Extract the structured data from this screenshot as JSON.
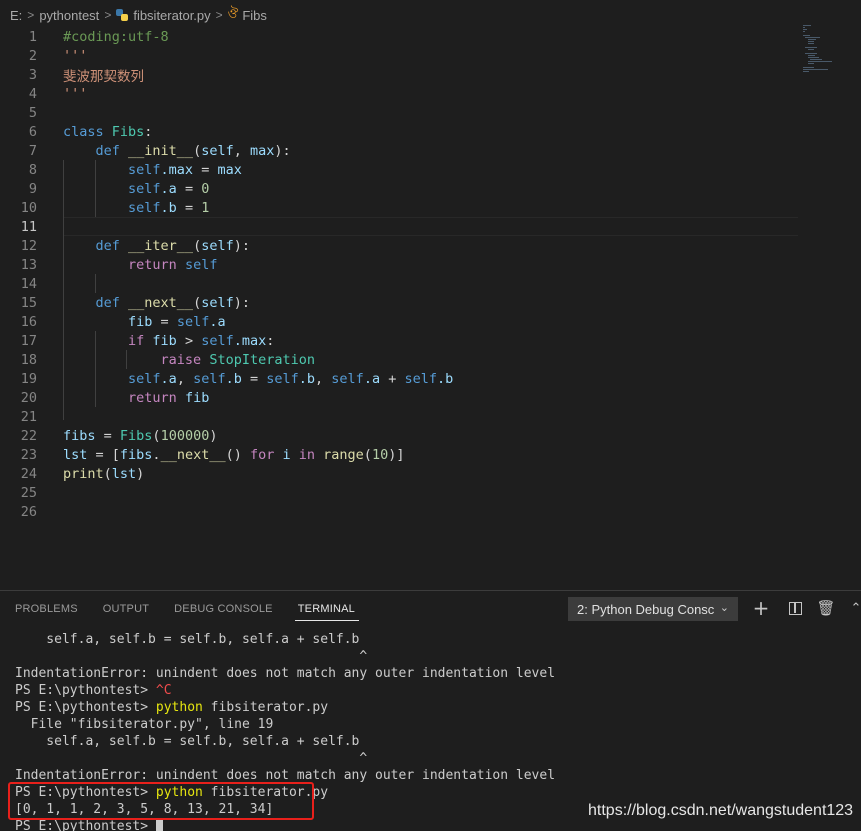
{
  "breadcrumb": {
    "root": "E:",
    "folder": "pythontest",
    "file": "fibsiterator.py",
    "symbol": "Fibs"
  },
  "editor": {
    "current_line": 11,
    "lines": [
      {
        "n": "1",
        "tokens": [
          {
            "t": "#coding:utf-8",
            "c": "com"
          }
        ]
      },
      {
        "n": "2",
        "tokens": [
          {
            "t": "'''",
            "c": "str"
          }
        ]
      },
      {
        "n": "3",
        "tokens": [
          {
            "t": "斐波那契数列",
            "c": "str"
          }
        ]
      },
      {
        "n": "4",
        "tokens": [
          {
            "t": "'''",
            "c": "str"
          }
        ]
      },
      {
        "n": "5",
        "tokens": []
      },
      {
        "n": "6",
        "tokens": [
          {
            "t": "class ",
            "c": "kw"
          },
          {
            "t": "Fibs",
            "c": "cls"
          },
          {
            "t": ":",
            "c": "plain"
          }
        ]
      },
      {
        "n": "7",
        "tokens": [
          {
            "t": "    ",
            "c": "plain"
          },
          {
            "t": "def ",
            "c": "kw"
          },
          {
            "t": "__init__",
            "c": "fn"
          },
          {
            "t": "(",
            "c": "plain"
          },
          {
            "t": "self",
            "c": "var"
          },
          {
            "t": ", ",
            "c": "plain"
          },
          {
            "t": "max",
            "c": "var"
          },
          {
            "t": "):",
            "c": "plain"
          }
        ]
      },
      {
        "n": "8",
        "tokens": [
          {
            "t": "        ",
            "c": "plain"
          },
          {
            "t": "self",
            "c": "self"
          },
          {
            "t": ".max",
            "c": "var"
          },
          {
            "t": " = ",
            "c": "plain"
          },
          {
            "t": "max",
            "c": "var"
          }
        ]
      },
      {
        "n": "9",
        "tokens": [
          {
            "t": "        ",
            "c": "plain"
          },
          {
            "t": "self",
            "c": "self"
          },
          {
            "t": ".a",
            "c": "var"
          },
          {
            "t": " = ",
            "c": "plain"
          },
          {
            "t": "0",
            "c": "num"
          }
        ]
      },
      {
        "n": "10",
        "tokens": [
          {
            "t": "        ",
            "c": "plain"
          },
          {
            "t": "self",
            "c": "self"
          },
          {
            "t": ".b",
            "c": "var"
          },
          {
            "t": " = ",
            "c": "plain"
          },
          {
            "t": "1",
            "c": "num"
          }
        ]
      },
      {
        "n": "11",
        "tokens": []
      },
      {
        "n": "12",
        "tokens": [
          {
            "t": "    ",
            "c": "plain"
          },
          {
            "t": "def ",
            "c": "kw"
          },
          {
            "t": "__iter__",
            "c": "fn"
          },
          {
            "t": "(",
            "c": "plain"
          },
          {
            "t": "self",
            "c": "var"
          },
          {
            "t": "):",
            "c": "plain"
          }
        ]
      },
      {
        "n": "13",
        "tokens": [
          {
            "t": "        ",
            "c": "plain"
          },
          {
            "t": "return ",
            "c": "ctl"
          },
          {
            "t": "self",
            "c": "self"
          }
        ]
      },
      {
        "n": "14",
        "tokens": []
      },
      {
        "n": "15",
        "tokens": [
          {
            "t": "    ",
            "c": "plain"
          },
          {
            "t": "def ",
            "c": "kw"
          },
          {
            "t": "__next__",
            "c": "fn"
          },
          {
            "t": "(",
            "c": "plain"
          },
          {
            "t": "self",
            "c": "var"
          },
          {
            "t": "):",
            "c": "plain"
          }
        ]
      },
      {
        "n": "16",
        "tokens": [
          {
            "t": "        ",
            "c": "plain"
          },
          {
            "t": "fib",
            "c": "var"
          },
          {
            "t": " = ",
            "c": "plain"
          },
          {
            "t": "self",
            "c": "self"
          },
          {
            "t": ".a",
            "c": "var"
          }
        ]
      },
      {
        "n": "17",
        "tokens": [
          {
            "t": "        ",
            "c": "plain"
          },
          {
            "t": "if ",
            "c": "ctl"
          },
          {
            "t": "fib",
            "c": "var"
          },
          {
            "t": " > ",
            "c": "plain"
          },
          {
            "t": "self",
            "c": "self"
          },
          {
            "t": ".max",
            "c": "var"
          },
          {
            "t": ":",
            "c": "plain"
          }
        ]
      },
      {
        "n": "18",
        "tokens": [
          {
            "t": "            ",
            "c": "plain"
          },
          {
            "t": "raise ",
            "c": "ctl"
          },
          {
            "t": "StopIteration",
            "c": "cls"
          }
        ]
      },
      {
        "n": "19",
        "tokens": [
          {
            "t": "        ",
            "c": "plain"
          },
          {
            "t": "self",
            "c": "self"
          },
          {
            "t": ".a",
            "c": "var"
          },
          {
            "t": ", ",
            "c": "plain"
          },
          {
            "t": "self",
            "c": "self"
          },
          {
            "t": ".b",
            "c": "var"
          },
          {
            "t": " = ",
            "c": "plain"
          },
          {
            "t": "self",
            "c": "self"
          },
          {
            "t": ".b",
            "c": "var"
          },
          {
            "t": ", ",
            "c": "plain"
          },
          {
            "t": "self",
            "c": "self"
          },
          {
            "t": ".a",
            "c": "var"
          },
          {
            "t": " + ",
            "c": "plain"
          },
          {
            "t": "self",
            "c": "self"
          },
          {
            "t": ".b",
            "c": "var"
          }
        ]
      },
      {
        "n": "20",
        "tokens": [
          {
            "t": "        ",
            "c": "plain"
          },
          {
            "t": "return ",
            "c": "ctl"
          },
          {
            "t": "fib",
            "c": "var"
          }
        ]
      },
      {
        "n": "21",
        "tokens": []
      },
      {
        "n": "22",
        "tokens": [
          {
            "t": "fibs",
            "c": "var"
          },
          {
            "t": " = ",
            "c": "plain"
          },
          {
            "t": "Fibs",
            "c": "cls"
          },
          {
            "t": "(",
            "c": "plain"
          },
          {
            "t": "100000",
            "c": "num"
          },
          {
            "t": ")",
            "c": "plain"
          }
        ]
      },
      {
        "n": "23",
        "tokens": [
          {
            "t": "lst",
            "c": "var"
          },
          {
            "t": " = [",
            "c": "plain"
          },
          {
            "t": "fibs",
            "c": "var"
          },
          {
            "t": ".",
            "c": "plain"
          },
          {
            "t": "__next__",
            "c": "fn"
          },
          {
            "t": "() ",
            "c": "plain"
          },
          {
            "t": "for ",
            "c": "ctl"
          },
          {
            "t": "i",
            "c": "var"
          },
          {
            "t": " in ",
            "c": "ctl"
          },
          {
            "t": "range",
            "c": "fn"
          },
          {
            "t": "(",
            "c": "plain"
          },
          {
            "t": "10",
            "c": "num"
          },
          {
            "t": ")]",
            "c": "plain"
          }
        ]
      },
      {
        "n": "24",
        "tokens": [
          {
            "t": "print",
            "c": "fn"
          },
          {
            "t": "(",
            "c": "plain"
          },
          {
            "t": "lst",
            "c": "var"
          },
          {
            "t": ")",
            "c": "plain"
          }
        ]
      },
      {
        "n": "25",
        "tokens": []
      },
      {
        "n": "26",
        "tokens": []
      }
    ]
  },
  "panel": {
    "tabs": [
      "PROBLEMS",
      "OUTPUT",
      "DEBUG CONSOLE",
      "TERMINAL"
    ],
    "active_tab": 3,
    "terminal_select": "2: Python Debug Consc",
    "terminal_lines": [
      [
        {
          "t": "    self.a, self.b = self.b, self.a + self.b",
          "c": ""
        }
      ],
      [
        {
          "t": "                                            ^",
          "c": ""
        }
      ],
      [
        {
          "t": "IndentationError: unindent does not match any outer indentation level",
          "c": ""
        }
      ],
      [
        {
          "t": "PS E:\\pythontest> ",
          "c": ""
        },
        {
          "t": "^C",
          "c": "red"
        }
      ],
      [
        {
          "t": "PS E:\\pythontest> ",
          "c": ""
        },
        {
          "t": "python",
          "c": "yellow"
        },
        {
          "t": " fibsiterator.py",
          "c": ""
        }
      ],
      [
        {
          "t": "  File \"fibsiterator.py\", line 19",
          "c": ""
        }
      ],
      [
        {
          "t": "    self.a, self.b = self.b, self.a + self.b",
          "c": ""
        }
      ],
      [
        {
          "t": "                                            ^",
          "c": ""
        }
      ],
      [
        {
          "t": "IndentationError: unindent does not match any outer indentation level",
          "c": ""
        }
      ],
      [
        {
          "t": "PS E:\\pythontest> ",
          "c": ""
        },
        {
          "t": "python",
          "c": "yellow"
        },
        {
          "t": " fibsiterator.py",
          "c": ""
        }
      ],
      [
        {
          "t": "[0, 1, 1, 2, 3, 5, 8, 13, 21, 34]",
          "c": ""
        }
      ],
      [
        {
          "t": "PS E:\\pythontest> ",
          "c": ""
        }
      ]
    ]
  },
  "watermark": "https://blog.csdn.net/wangstudent123"
}
